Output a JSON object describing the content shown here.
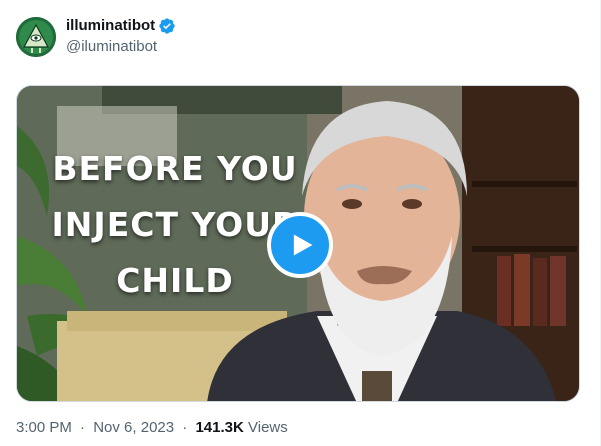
{
  "author": {
    "display_name": "illuminatibot",
    "handle": "@iluminatibot",
    "verified_icon": "verified-badge-icon",
    "avatar_icon": "illuminati-pyramid-eye-icon"
  },
  "media": {
    "overlay_lines": [
      "BEFORE YOU",
      "INJECT YOUR",
      "CHILD"
    ],
    "play_icon": "play-icon"
  },
  "meta": {
    "time": "3:00 PM",
    "separator": "·",
    "date": "Nov 6, 2023",
    "views_count": "141.3K",
    "views_label": "Views"
  },
  "colors": {
    "accent": "#1d9bf0",
    "text_primary": "#0f1419",
    "text_secondary": "#536471"
  }
}
